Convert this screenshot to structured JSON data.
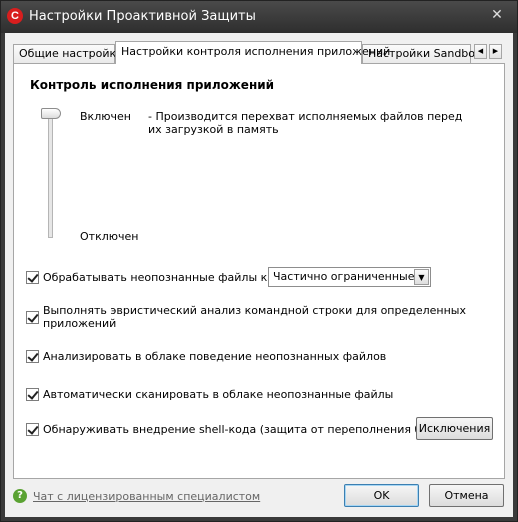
{
  "window": {
    "title": "Настройки Проактивной Защиты",
    "close_glyph": "✕"
  },
  "tabs": [
    {
      "label": "Общие настройки",
      "active": false
    },
    {
      "label": "Настройки контроля исполнения приложений",
      "active": true
    },
    {
      "label": "Настройки Sandbox",
      "active": false
    }
  ],
  "tab_scroll": {
    "left": "◀",
    "right": "▶"
  },
  "section": {
    "title": "Контроль исполнения приложений",
    "level_on": "Включен",
    "level_on_description": "- Производится перехват исполняемых файлов перед их загрузкой в память",
    "level_off": "Отключен"
  },
  "options": [
    {
      "label": "Обрабатывать неопознанные файлы как",
      "checked": true
    },
    {
      "label": "Выполнять эвристический анализ командной строки для определенных приложений",
      "checked": true
    },
    {
      "label": "Анализировать в облаке поведение неопознанных файлов",
      "checked": true
    },
    {
      "label": "Автоматически сканировать в облаке неопознанные файлы",
      "checked": true
    },
    {
      "label": "Обнаруживать внедрение shell-кода (защита от переполнения буфера)",
      "checked": true
    }
  ],
  "combo": {
    "selected": "Частично ограниченные",
    "arrow": "▼"
  },
  "buttons": {
    "exceptions": "Исключения",
    "ok": "OK",
    "cancel": "Отмена"
  },
  "footer": {
    "help_glyph": "?",
    "chat_link": "Чат с лицензированным специалистом"
  },
  "icons": {
    "app": "C"
  },
  "colors": {
    "app_icon": "#d81e1e",
    "help_icon": "#5aa232"
  }
}
